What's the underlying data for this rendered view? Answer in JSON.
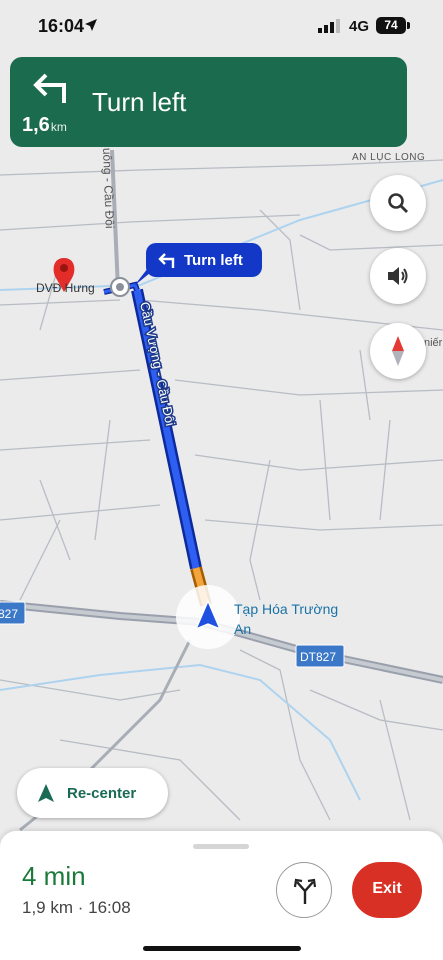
{
  "status_bar": {
    "time": "16:04",
    "network": "4G",
    "battery": "74"
  },
  "instruction": {
    "title": "Turn left",
    "distance_value": "1,6",
    "distance_unit": "km"
  },
  "map": {
    "labels": {
      "area_top_right": "AN LỤC LONG",
      "road_side_top": "uông - Cầu Đôi",
      "road_main": "Cầu Vượng - Cầu Đôi",
      "destination": "DVĐ Hưng",
      "shop": "Tạp Hóa Trường",
      "shop_line2": "An",
      "right_edge": "niếr",
      "route_left": "827",
      "route_badge": "DT827"
    },
    "callout": "Turn left"
  },
  "controls": {
    "search_icon": "search-icon",
    "sound_icon": "volume-icon",
    "compass_icon": "compass-icon"
  },
  "recenter": {
    "label": "Re-center"
  },
  "trip": {
    "eta": "4 min",
    "meta": "1,9 km · 16:08",
    "exit_label": "Exit"
  },
  "colors": {
    "banner": "#1b6b4e",
    "route": "#1338c7",
    "exit": "#d93025",
    "eta": "#1b7a3a"
  }
}
